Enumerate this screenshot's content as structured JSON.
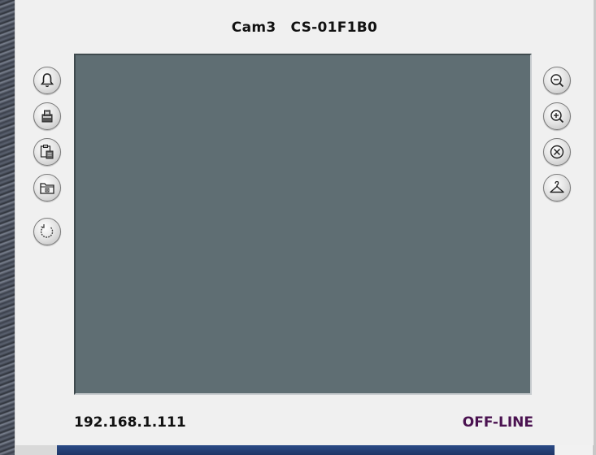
{
  "window": {
    "camera_name": "Cam3",
    "camera_id": "CS-01F1B0"
  },
  "left_toolbar": [
    {
      "name": "alarm-bell-icon"
    },
    {
      "name": "snapshot-icon"
    },
    {
      "name": "paste-clipboard-icon"
    },
    {
      "name": "folder-icon"
    },
    {
      "name": "refresh-icon"
    }
  ],
  "right_toolbar": [
    {
      "name": "zoom-out-icon"
    },
    {
      "name": "zoom-in-icon"
    },
    {
      "name": "close-circle-icon"
    },
    {
      "name": "hanger-icon"
    }
  ],
  "footer": {
    "ip_address": "192.168.1.111",
    "status": "OFF-LINE",
    "status_color": "#4a1250"
  },
  "video": {
    "background_color": "#5f6e73"
  }
}
